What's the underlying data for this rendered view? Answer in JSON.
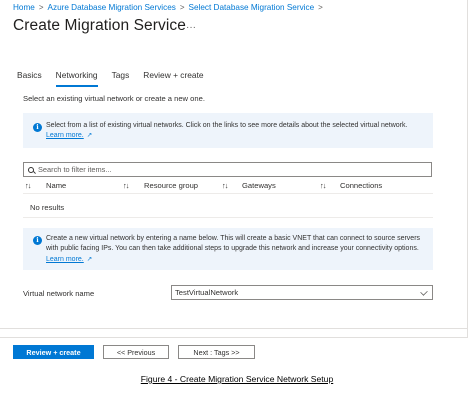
{
  "breadcrumb": {
    "items": [
      "Home",
      "Azure Database Migration Services",
      "Select Database Migration Service"
    ],
    "separator": ">"
  },
  "page": {
    "title": "Create Migration Service",
    "more": "···"
  },
  "tabs": [
    {
      "label": "Basics",
      "active": false
    },
    {
      "label": "Networking",
      "active": true
    },
    {
      "label": "Tags",
      "active": false
    },
    {
      "label": "Review + create",
      "active": false
    }
  ],
  "networking": {
    "intro": "Select an existing virtual network or create a new one.",
    "info_existing": {
      "text": "Select from a list of existing virtual networks. Click on the links to see more details about the selected virtual network.",
      "link": "Learn more."
    },
    "filter": {
      "placeholder": "Search to filter items..."
    },
    "grid": {
      "columns": [
        "Name",
        "Resource group",
        "Gateways",
        "Connections"
      ],
      "sort_glyph": "↑↓",
      "empty_text": "No results"
    },
    "info_new": {
      "text": "Create a new virtual network by entering a name below. This will create a basic VNET that can connect to source servers with public facing IPs. You can then take additional steps to upgrade this network and increase your connectivity options.",
      "link": "Learn more."
    },
    "vnet": {
      "label": "Virtual network name",
      "value": "TestVirtualNetwork"
    }
  },
  "footer": {
    "review_create": "Review + create",
    "previous": "<< Previous",
    "next": "Next : Tags >>"
  },
  "caption": "Figure 4 - Create Migration Service Network Setup",
  "colors": {
    "accent": "#0078d4",
    "info_background": "#eef4fb",
    "text": "#323130"
  },
  "icons": {
    "info": "info-icon",
    "external_link": "external-link-icon",
    "search": "search-icon",
    "sort": "sort-arrows-icon",
    "valid": "checkmark-icon"
  }
}
